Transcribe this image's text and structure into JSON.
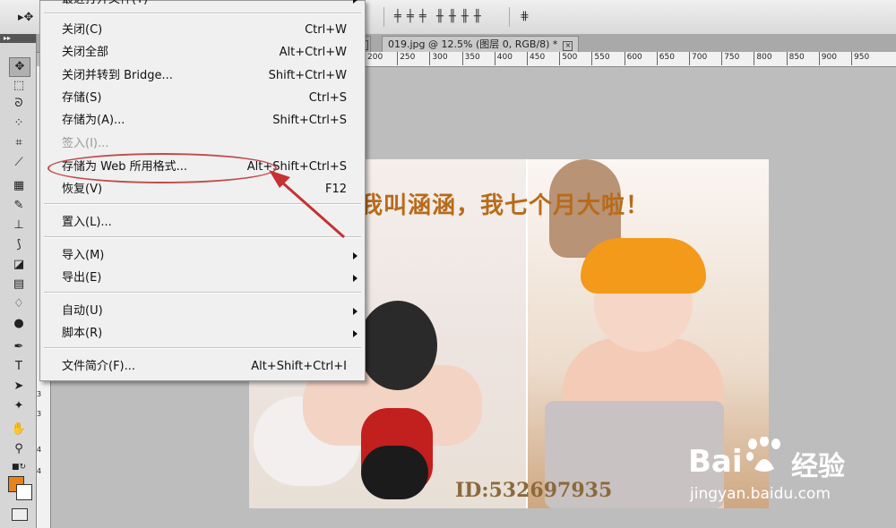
{
  "document_tab": {
    "title": "019.jpg @ 12.5% (图层 0, RGB/8) *",
    "close_label": "×"
  },
  "ruler_h": [
    200,
    250,
    300,
    350,
    400,
    450,
    500,
    550,
    600,
    650,
    700,
    750,
    800,
    850,
    900,
    950
  ],
  "ruler_v": [
    "3",
    "3",
    "4",
    "4"
  ],
  "menu": {
    "partial_top_label": "最近打开文件(T)",
    "items": [
      {
        "label": "关闭(C)",
        "shortcut": "Ctrl+W"
      },
      {
        "label": "关闭全部",
        "shortcut": "Alt+Ctrl+W"
      },
      {
        "label": "关闭并转到 Bridge...",
        "shortcut": "Shift+Ctrl+W"
      },
      {
        "label": "存储(S)",
        "shortcut": "Ctrl+S"
      },
      {
        "label": "存储为(A)...",
        "shortcut": "Shift+Ctrl+S"
      },
      {
        "label": "签入(I)...",
        "shortcut": "",
        "disabled": true
      },
      {
        "label": "存储为 Web 所用格式...",
        "shortcut": "Alt+Shift+Ctrl+S",
        "highlighted": true
      },
      {
        "label": "恢复(V)",
        "shortcut": "F12"
      },
      {
        "label": "置入(L)...",
        "shortcut": ""
      },
      {
        "label": "导入(M)",
        "shortcut": "",
        "submenu": true
      },
      {
        "label": "导出(E)",
        "shortcut": "",
        "submenu": true
      },
      {
        "label": "自动(U)",
        "shortcut": "",
        "submenu": true
      },
      {
        "label": "脚本(R)",
        "shortcut": "",
        "submenu": true
      },
      {
        "label": "文件简介(F)...",
        "shortcut": "Alt+Shift+Ctrl+I"
      }
    ]
  },
  "canvas": {
    "caption": "我叫涵涵，我七个月大啦！",
    "watermark_id": "ID:532697935"
  },
  "watermark": {
    "brand_left": "Bai",
    "brand_right": "经验",
    "url": "jingyan.baidu.com"
  },
  "colors": {
    "foreground": "#e8821a",
    "background": "#ffffff",
    "annotation": "#c24a4a"
  },
  "icons": [
    "move-tool-icon",
    "marquee-icon",
    "lasso-icon",
    "quick-select-icon",
    "crop-icon",
    "eyedropper-icon",
    "healing-brush-icon",
    "brush-icon",
    "clone-stamp-icon",
    "history-brush-icon",
    "eraser-icon",
    "gradient-icon",
    "blur-icon",
    "dodge-icon",
    "pen-icon",
    "type-icon",
    "path-select-icon",
    "shape-icon",
    "hand-icon",
    "zoom-icon"
  ]
}
